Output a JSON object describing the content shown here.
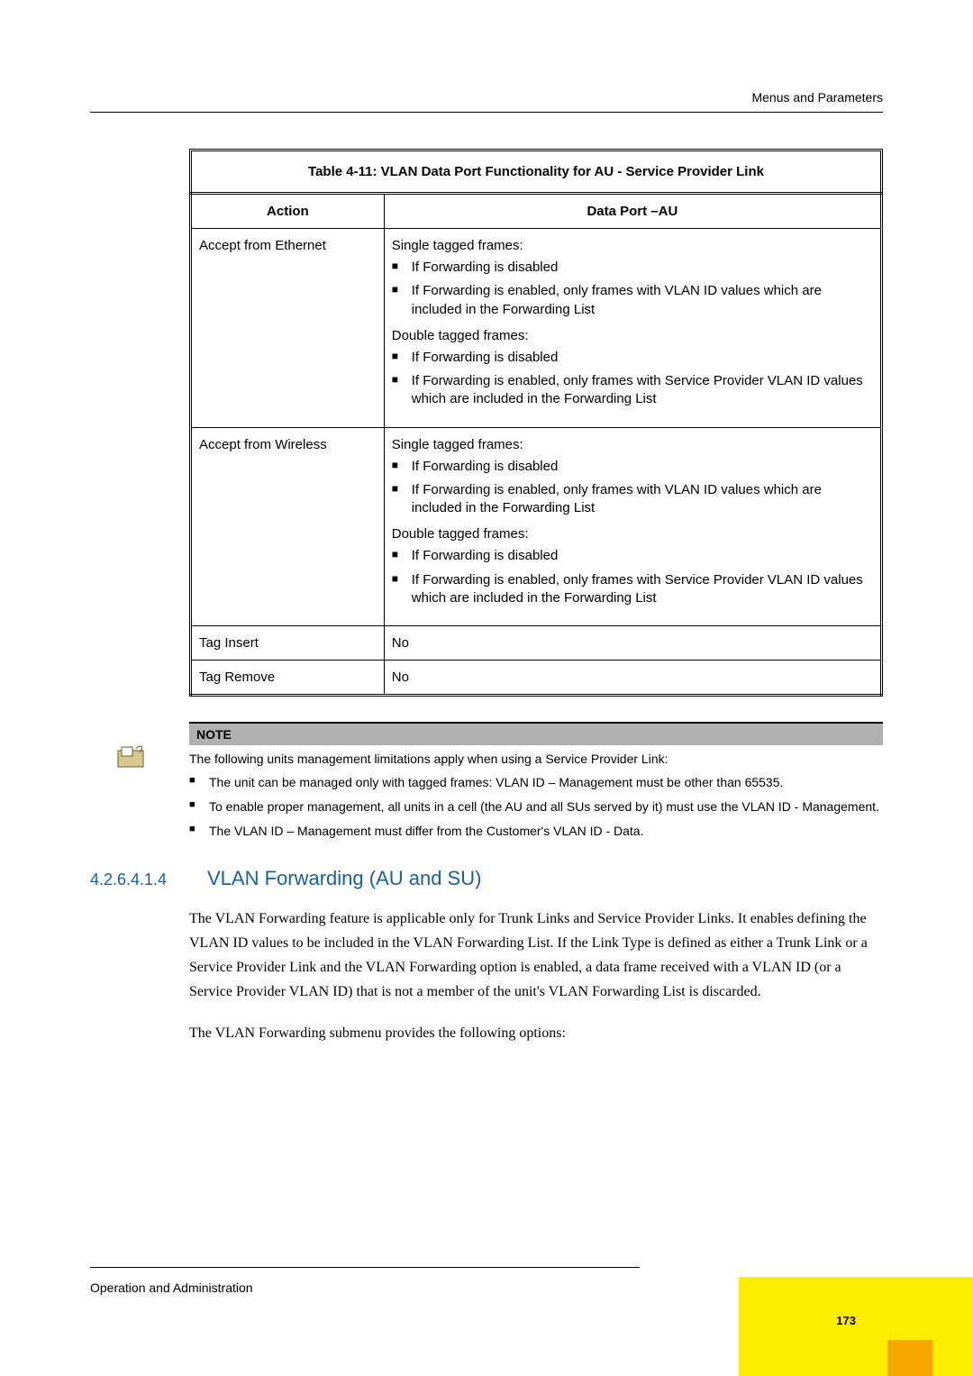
{
  "header": {
    "running": "Menus and Parameters"
  },
  "table": {
    "caption": "Table 4-11: VLAN Data Port Functionality for AU - Service Provider Link",
    "col_action": "Action",
    "col_data_port": "Data Port –AU",
    "rows": {
      "r1_action": "Accept from Ethernet",
      "r1_single_label": "Single tagged frames:",
      "r1_s_b1": "If Forwarding is disabled",
      "r1_s_b2": "If Forwarding is enabled, only frames with VLAN ID values which are included in the Forwarding List",
      "r1_double_label": "Double tagged frames:",
      "r1_d_b1": "If Forwarding is disabled",
      "r1_d_b2": "If Forwarding is enabled, only frames with Service Provider VLAN ID values which are included in the Forwarding List",
      "r2_action": "Accept from Wireless",
      "r2_single_label": "Single tagged frames:",
      "r2_s_b1": "If Forwarding is disabled",
      "r2_s_b2": "If Forwarding is enabled, only frames with VLAN ID values which are included in the Forwarding List",
      "r2_double_label": "Double tagged frames:",
      "r2_d_b1": "If Forwarding is disabled",
      "r2_d_b2": "If Forwarding is enabled, only frames with Service Provider VLAN ID values which are included in the Forwarding List",
      "r3_action": "Tag Insert",
      "r3_value": "No",
      "r4_action": "Tag Remove",
      "r4_value": "No"
    }
  },
  "note": {
    "label": "NOTE",
    "intro": "The following units management limitations apply when using a Service Provider Link:",
    "b1": "The unit can be managed only with tagged frames: VLAN ID – Management must be other than 65535.",
    "b2": "To enable proper management, all units in a cell (the AU and all SUs served by it) must use the VLAN ID - Management.",
    "b3": "The VLAN ID – Management must differ from the Customer's VLAN ID - Data."
  },
  "section": {
    "number": "4.2.6.4.1.4",
    "title": "VLAN Forwarding (AU and SU)",
    "para1": "The VLAN Forwarding feature is applicable only for Trunk Links and Service Provider Links. It enables defining the VLAN ID values to be included in the VLAN Forwarding List. If the Link Type is defined as either a Trunk Link or a Service Provider Link and the VLAN Forwarding option is enabled, a data frame received with a VLAN ID (or a Service Provider VLAN ID) that is not a member of the unit's VLAN Forwarding List is discarded.",
    "para2": "The VLAN Forwarding submenu provides the following options:"
  },
  "footer": {
    "left": "Operation and Administration",
    "page": "173"
  }
}
